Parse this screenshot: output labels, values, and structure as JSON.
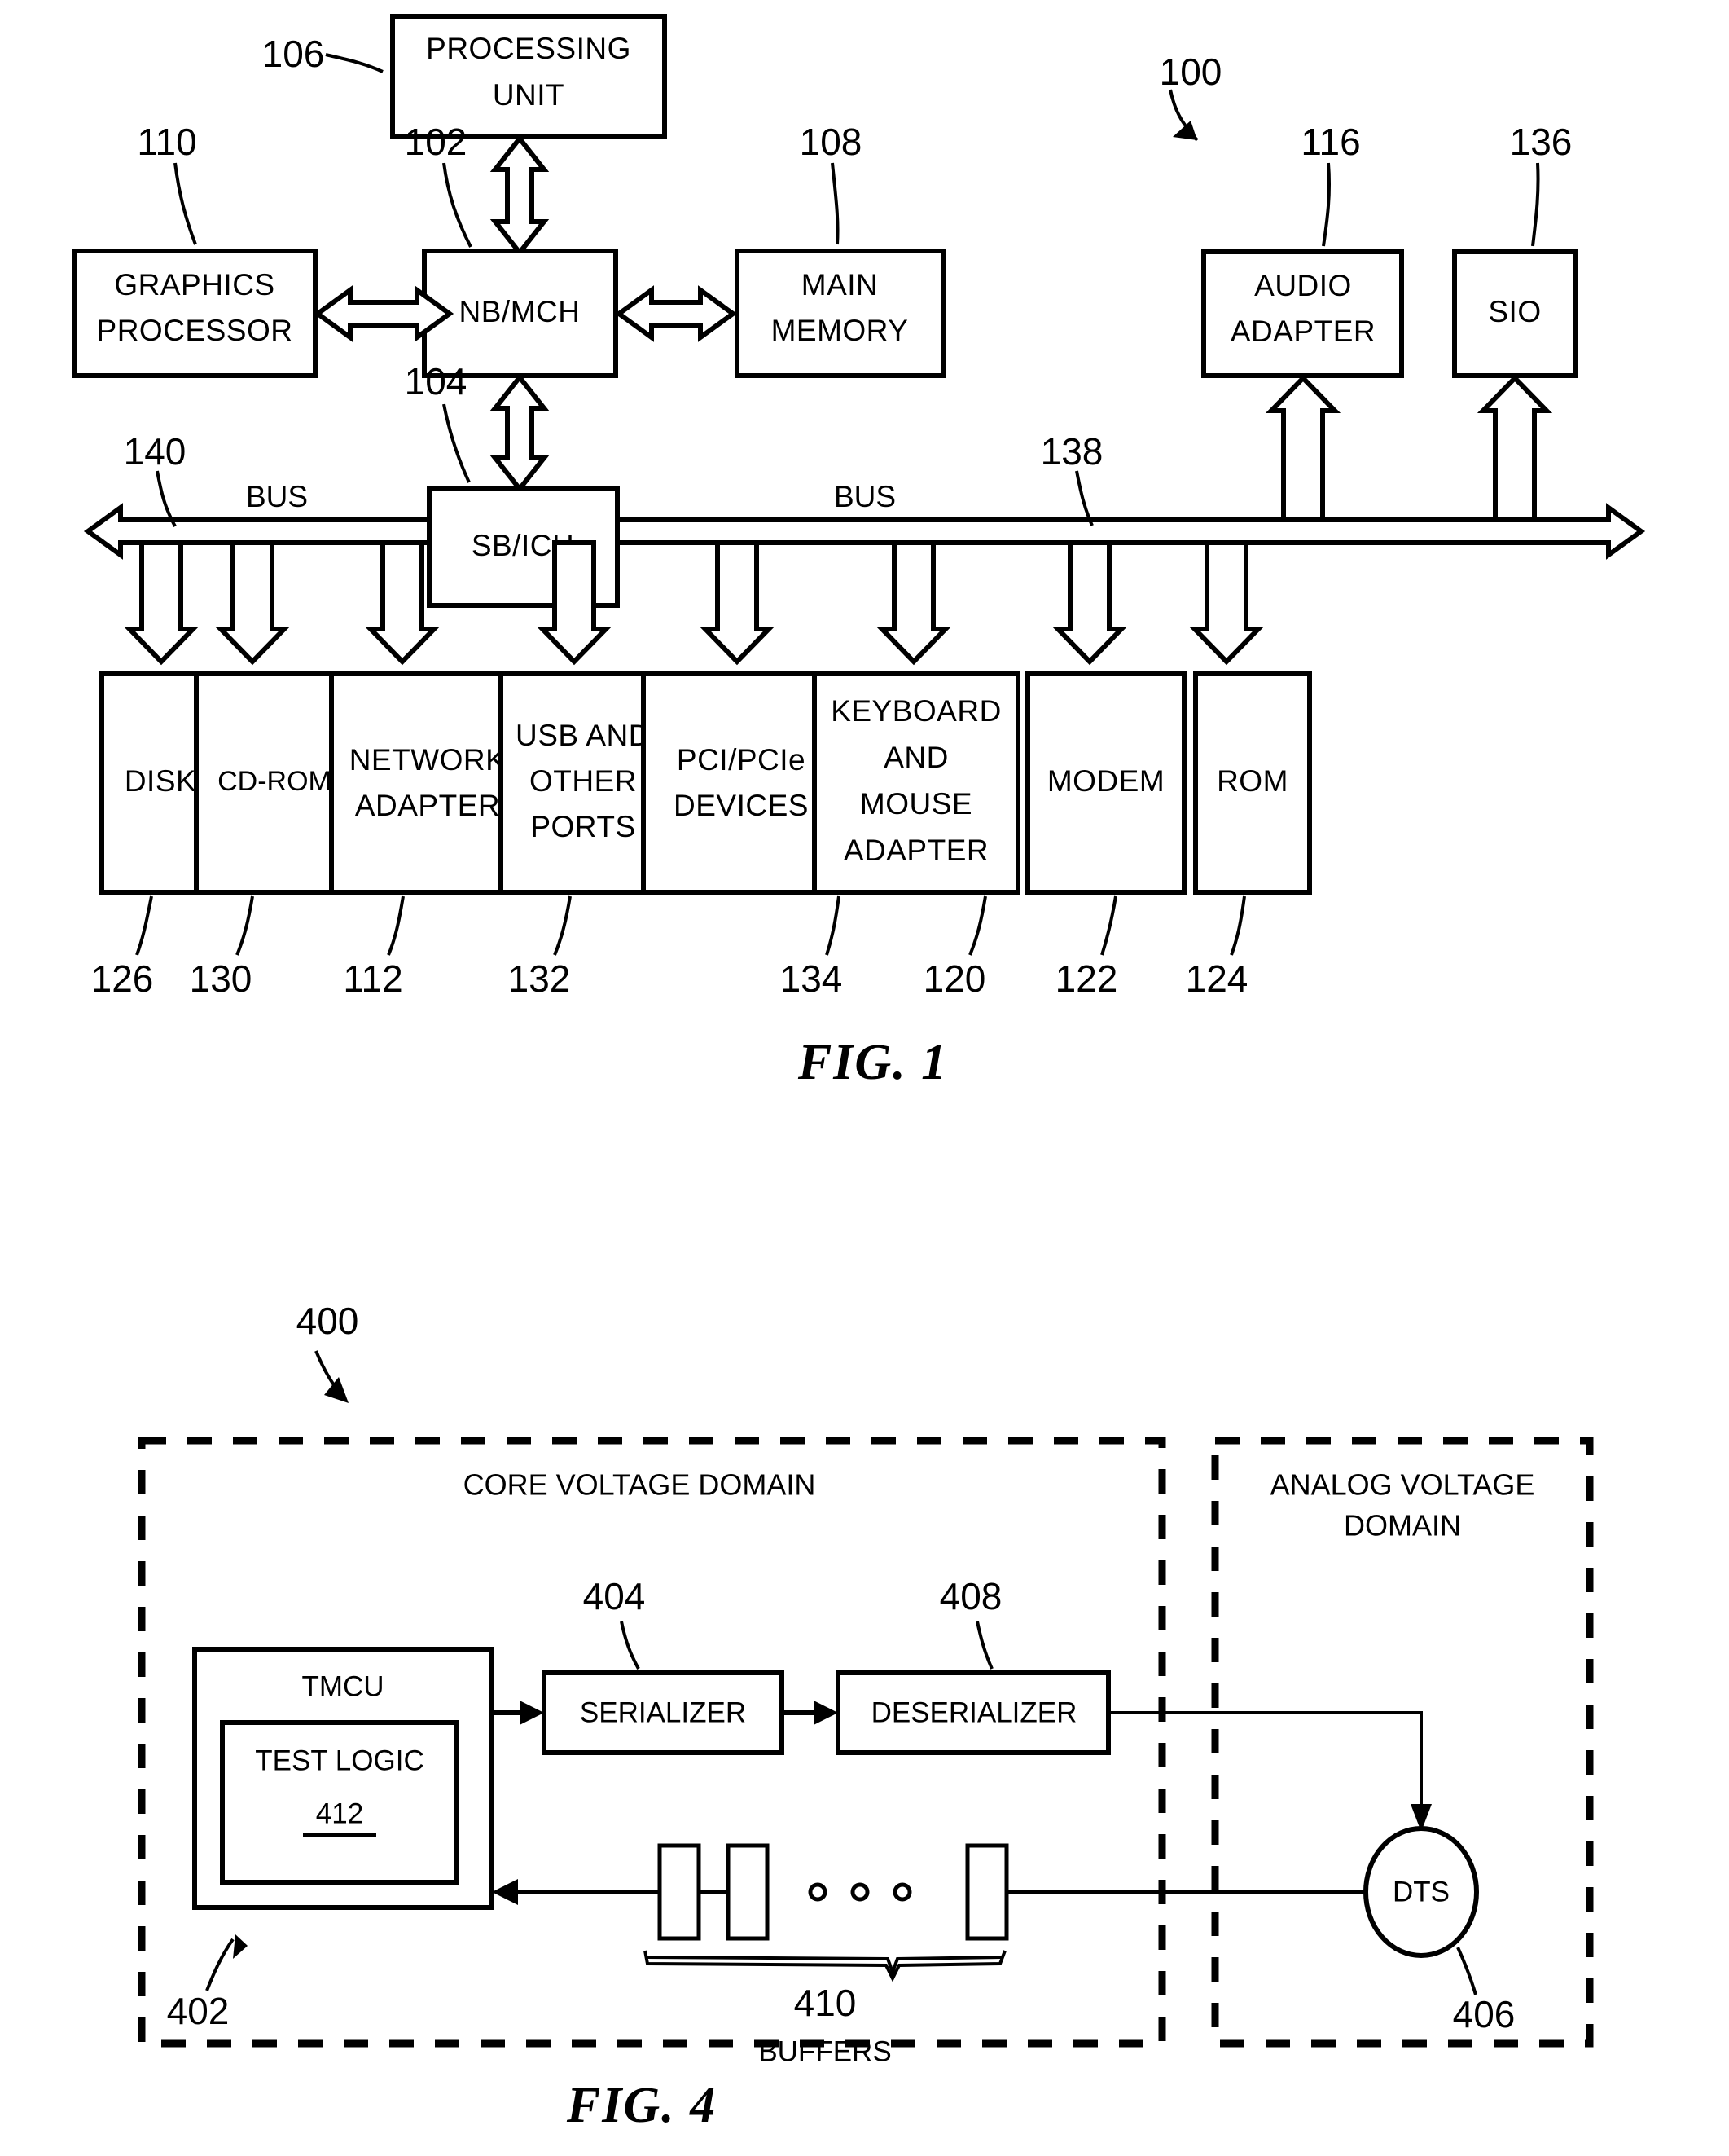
{
  "figure1": {
    "caption": "FIG. 1",
    "system_ref": "100",
    "bus_label_left": "BUS",
    "bus_label_right": "BUS",
    "blocks": {
      "processing_unit": {
        "label_line1": "PROCESSING",
        "label_line2": "UNIT",
        "ref": "106"
      },
      "nb_mch": {
        "label": "NB/MCH",
        "ref": "102"
      },
      "graphics_processor": {
        "label_line1": "GRAPHICS",
        "label_line2": "PROCESSOR",
        "ref": "110"
      },
      "main_memory": {
        "label_line1": "MAIN",
        "label_line2": "MEMORY",
        "ref": "108"
      },
      "audio_adapter": {
        "label_line1": "AUDIO",
        "label_line2": "ADAPTER",
        "ref": "116"
      },
      "sio": {
        "label": "SIO",
        "ref": "136"
      },
      "sb_ich": {
        "label": "SB/ICH",
        "ref": "104"
      },
      "disk": {
        "label": "DISK",
        "ref": "126"
      },
      "cdrom": {
        "label": "CD-ROM",
        "ref": "130"
      },
      "network_adapter": {
        "label_line1": "NETWORK",
        "label_line2": "ADAPTER",
        "ref": "112"
      },
      "usb_ports": {
        "label_line1": "USB AND",
        "label_line2": "OTHER",
        "label_line3": "PORTS",
        "ref": "132"
      },
      "pci_devices": {
        "label_line1": "PCI/PCIe",
        "label_line2": "DEVICES",
        "ref": "134"
      },
      "keyboard_mouse": {
        "label_line1": "KEYBOARD",
        "label_line2": "AND",
        "label_line3": "MOUSE",
        "label_line4": "ADAPTER",
        "ref": "120"
      },
      "modem": {
        "label": "MODEM",
        "ref": "122"
      },
      "rom": {
        "label": "ROM",
        "ref": "124"
      }
    },
    "bus_refs": {
      "left_bus": "140",
      "right_bus": "138"
    }
  },
  "figure4": {
    "caption": "FIG. 4",
    "system_ref": "400",
    "domains": {
      "core": {
        "label": "CORE VOLTAGE DOMAIN"
      },
      "analog": {
        "label_line1": "ANALOG VOLTAGE",
        "label_line2": "DOMAIN"
      }
    },
    "blocks": {
      "tmcu": {
        "label": "TMCU",
        "ref": "402"
      },
      "test_logic": {
        "label": "TEST LOGIC",
        "ref": "412"
      },
      "serializer": {
        "label": "SERIALIZER",
        "ref": "404"
      },
      "deserializer": {
        "label": "DESERIALIZER",
        "ref": "408"
      },
      "dts": {
        "label": "DTS",
        "ref": "406"
      },
      "buffers": {
        "ref": "410",
        "label": "BUFFERS",
        "ellipsis": "o   o   o"
      }
    }
  },
  "colors": {
    "ink": "#000000",
    "paper": "#ffffff"
  }
}
